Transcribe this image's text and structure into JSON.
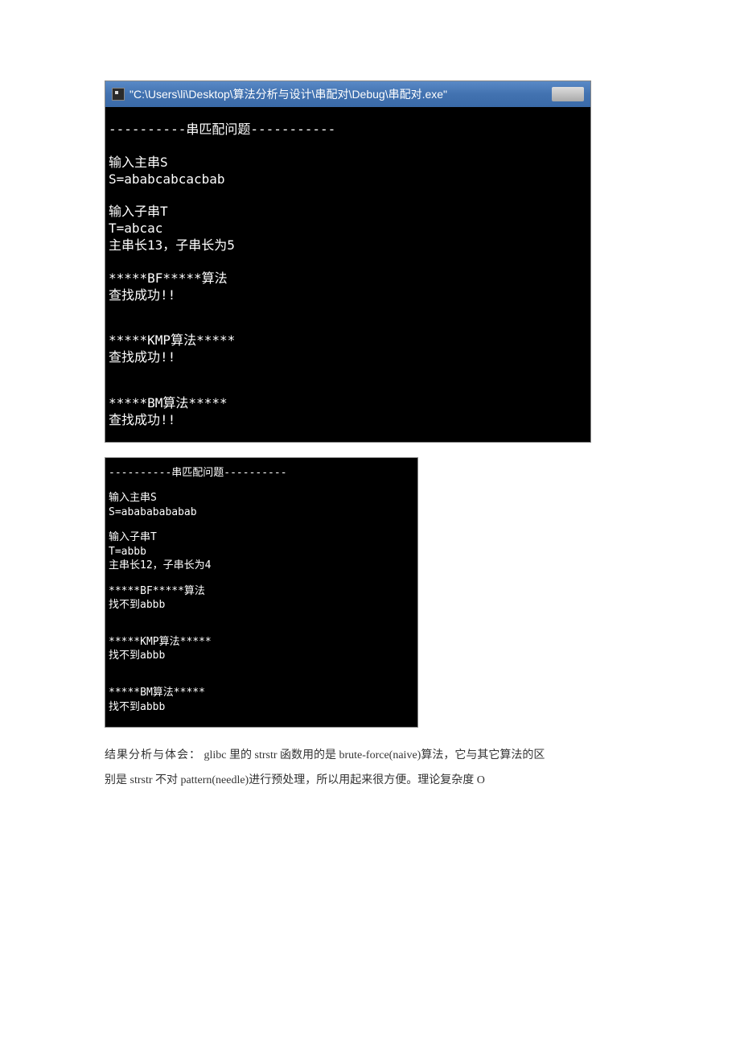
{
  "window1": {
    "title": "\"C:\\Users\\li\\Desktop\\算法分析与设计\\串配对\\Debug\\串配对.exe\"",
    "header": "----------串匹配问题-----------",
    "inputS_label": "输入主串S",
    "inputS_value": "S=ababcabcacbab",
    "inputT_label": "输入子串T",
    "inputT_value": "T=abcac",
    "length_info": "主串长13，子串长为5",
    "bf_title": "*****BF*****算法",
    "bf_result": "查找成功!!",
    "kmp_title": "*****KMP算法*****",
    "kmp_result": "查找成功!!",
    "bm_title": "*****BM算法*****",
    "bm_result": "查找成功!!"
  },
  "window2": {
    "header": "----------串匹配问题----------",
    "inputS_label": "输入主串S",
    "inputS_value": "S=abababababab",
    "inputT_label": "输入子串T",
    "inputT_value": "T=abbb",
    "length_info": "主串长12，子串长为4",
    "bf_title": "*****BF*****算法",
    "bf_result": "找不到abbb",
    "kmp_title": "*****KMP算法*****",
    "kmp_result": "找不到abbb",
    "bm_title": "*****BM算法*****",
    "bm_result": "找不到abbb"
  },
  "document": {
    "label": "结果分析与体会：",
    "text1": " glibc 里的 strstr 函数用的是 brute-force(naive)算法，它与其它算法的区",
    "text2": "别是 strstr 不对 pattern(needle)进行预处理，所以用起来很方便。理论复杂度 O"
  }
}
